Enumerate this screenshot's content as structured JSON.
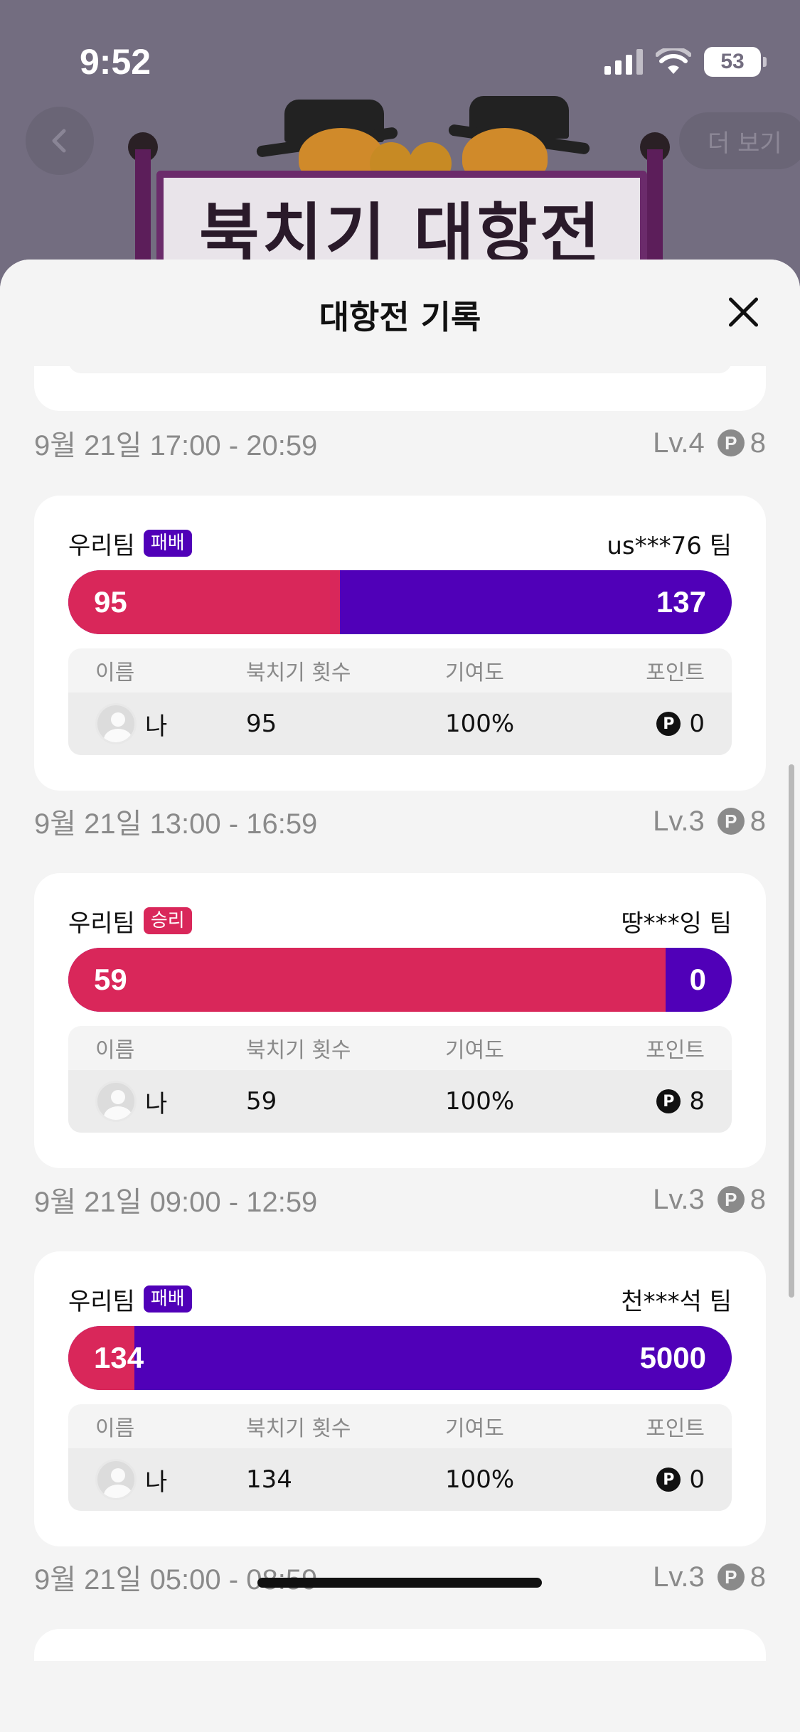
{
  "status_bar": {
    "time": "9:52",
    "battery": "53"
  },
  "banner": {
    "title": "북치기 대항전",
    "more_label": "더 보기"
  },
  "sheet": {
    "title": "대항전 기록"
  },
  "records": [
    {
      "date": "9월 21일 17:00 - 20:59",
      "level": "Lv.4",
      "reward": "8",
      "our_team": "우리팀",
      "result": "패배",
      "result_type": "lose",
      "opponent": "us***76 팀",
      "our_score": "95",
      "opp_score": "137",
      "our_share": 0.409,
      "headers": {
        "name": "이름",
        "hits": "북치기 횟수",
        "contrib": "기여도",
        "points": "포인트"
      },
      "player": {
        "name": "나",
        "hits": "95",
        "contrib": "100%",
        "points": "0"
      }
    },
    {
      "date": "9월 21일 13:00 - 16:59",
      "level": "Lv.3",
      "reward": "8",
      "our_team": "우리팀",
      "result": "승리",
      "result_type": "win",
      "opponent": "땅***잉 팀",
      "our_score": "59",
      "opp_score": "0",
      "our_share": 0.9,
      "headers": {
        "name": "이름",
        "hits": "북치기 횟수",
        "contrib": "기여도",
        "points": "포인트"
      },
      "player": {
        "name": "나",
        "hits": "59",
        "contrib": "100%",
        "points": "8"
      }
    },
    {
      "date": "9월 21일 09:00 - 12:59",
      "level": "Lv.3",
      "reward": "8",
      "our_team": "우리팀",
      "result": "패배",
      "result_type": "lose",
      "opponent": "천***석 팀",
      "our_score": "134",
      "opp_score": "5000",
      "our_share": 0.1,
      "headers": {
        "name": "이름",
        "hits": "북치기 횟수",
        "contrib": "기여도",
        "points": "포인트"
      },
      "player": {
        "name": "나",
        "hits": "134",
        "contrib": "100%",
        "points": "0"
      }
    },
    {
      "date": "9월 21일 05:00 - 08:59",
      "level": "Lv.3",
      "reward": "8"
    }
  ],
  "colors": {
    "our_team": "#d9275a",
    "opponent": "#5000b8",
    "sheet_bg": "#f4f4f4",
    "card_bg": "#ffffff"
  },
  "icons": {
    "back": "chevron-left-icon",
    "close": "close-icon",
    "point": "point-coin-icon",
    "avatar": "default-avatar-icon"
  }
}
